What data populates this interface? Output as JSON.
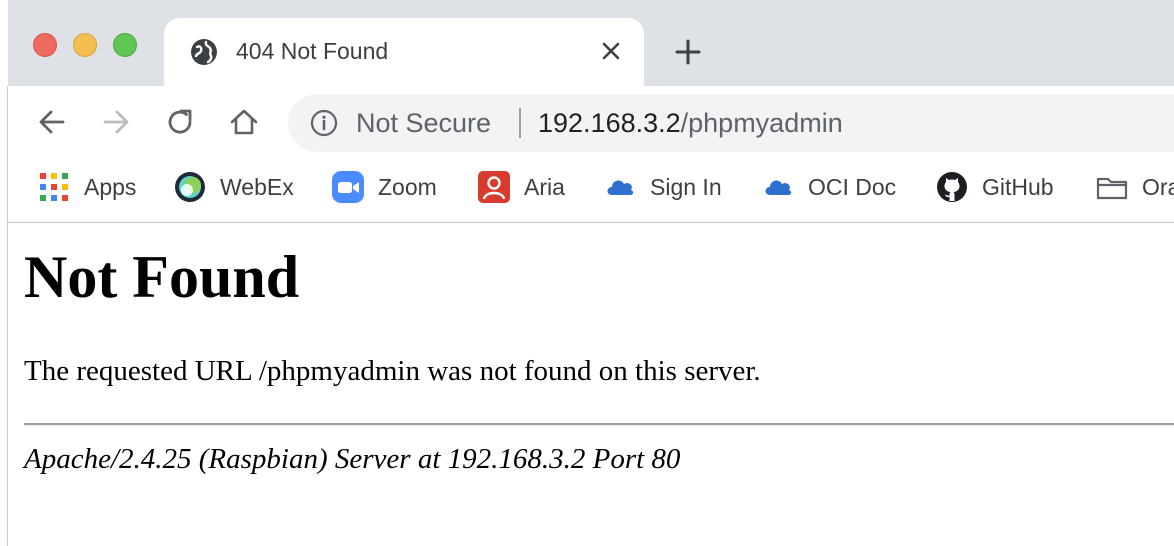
{
  "window": {
    "tab_title": "404 Not Found"
  },
  "toolbar": {
    "security_label": "Not Secure",
    "url_host": "192.168.3.2",
    "url_path": "/phpmyadmin"
  },
  "bookmarks": [
    {
      "label": "Apps",
      "icon": "apps-grid-icon"
    },
    {
      "label": "WebEx",
      "icon": "webex-icon"
    },
    {
      "label": "Zoom",
      "icon": "zoom-icon"
    },
    {
      "label": "Aria",
      "icon": "aria-icon"
    },
    {
      "label": "Sign In",
      "icon": "cloud-icon"
    },
    {
      "label": "OCI Doc",
      "icon": "cloud-icon"
    },
    {
      "label": "GitHub",
      "icon": "github-icon"
    },
    {
      "label": "Ora",
      "icon": "folder-icon"
    }
  ],
  "page": {
    "heading": "Not Found",
    "message": "The requested URL /phpmyadmin was not found on this server.",
    "address": "Apache/2.4.25 (Raspbian) Server at 192.168.3.2 Port 80"
  },
  "colors": {
    "tabstrip": "#dee1e6",
    "omnibox": "#f1f3f4",
    "close_light": "#ed6a5e",
    "minimize_light": "#f5bf4f",
    "maximize_light": "#61c554"
  }
}
